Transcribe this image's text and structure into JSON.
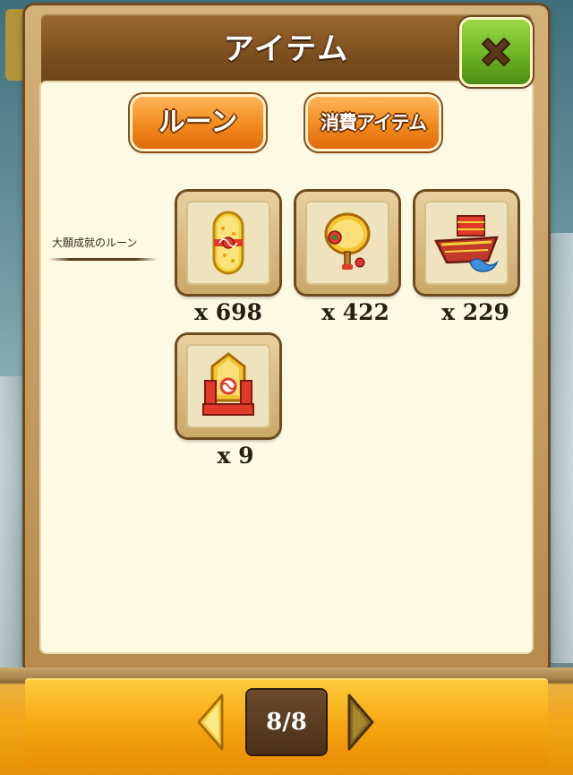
{
  "dialog": {
    "title": "アイテム",
    "close_icon": "close-x-icon"
  },
  "tabs": [
    {
      "label": "ルーン",
      "active": true
    },
    {
      "label": "消費アイテム",
      "active": false
    }
  ],
  "category": {
    "label": "大願成就のルーン"
  },
  "items": [
    {
      "icon": "omamori-charm-icon",
      "count": "x 698"
    },
    {
      "icon": "den-den-drum-icon",
      "count": "x 422"
    },
    {
      "icon": "treasure-ship-icon",
      "count": "x 229"
    },
    {
      "icon": "daruma-shrine-icon",
      "count": "x 9"
    }
  ],
  "pagination": {
    "page": "8/8",
    "prev_icon": "arrow-left-icon",
    "next_icon": "arrow-right-icon"
  },
  "colors": {
    "panel_bg": "#fdf9e3",
    "title_bar": "#7b4e1f",
    "tab_orange": "#f28a1d",
    "close_green": "#67b11f",
    "footer_orange": "#f5a50f"
  }
}
